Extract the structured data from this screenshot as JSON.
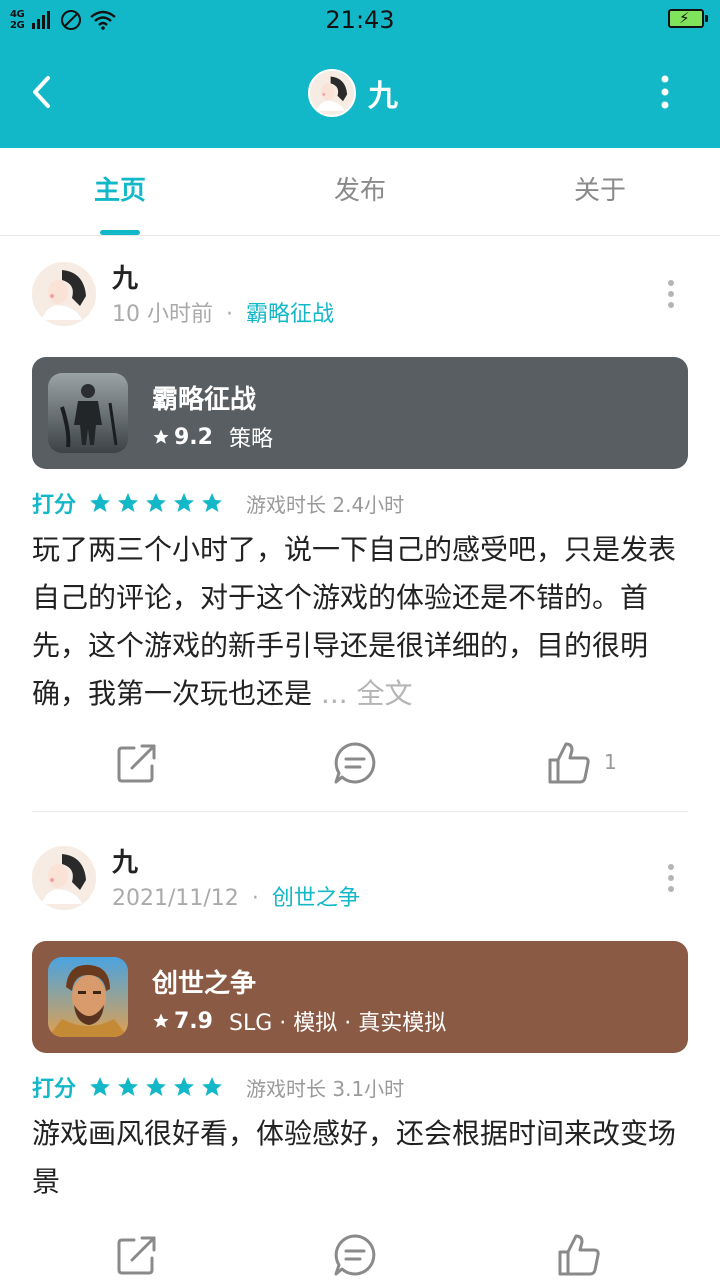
{
  "status_bar": {
    "network_top": "4G",
    "network_bottom": "2G",
    "time": "21:43"
  },
  "header": {
    "title": "九"
  },
  "tabs": [
    {
      "label": "主页",
      "active": true
    },
    {
      "label": "发布",
      "active": false
    },
    {
      "label": "关于",
      "active": false
    }
  ],
  "colors": {
    "accent": "#13b8c8",
    "card1_bg": "#595e62",
    "card2_bg": "#8a5a45"
  },
  "posts": [
    {
      "author": "九",
      "time": "10 小时前",
      "separator": "·",
      "game_link": "霸略征战",
      "game": {
        "name": "霸略征战",
        "score": "9.2",
        "tags": "策略"
      },
      "rating_label": "打分",
      "stars": 5,
      "playtime": "游戏时长 2.4小时",
      "text": "玩了两三个小时了，说一下自己的感受吧，只是发表自己的评论，对于这个游戏的体验还是不错的。首先，这个游戏的新手引导还是很详细的，目的很明确，我第一次玩也还是",
      "ellipsis": "...",
      "fulltext": "全文",
      "like_count": "1"
    },
    {
      "author": "九",
      "time": "2021/11/12",
      "separator": "·",
      "game_link": "创世之争",
      "game": {
        "name": "创世之争",
        "score": "7.9",
        "tags": "SLG · 模拟 · 真实模拟"
      },
      "rating_label": "打分",
      "stars": 5,
      "playtime": "游戏时长 3.1小时",
      "text": "游戏画风很好看，体验感好，还会根据时间来改变场景"
    }
  ]
}
